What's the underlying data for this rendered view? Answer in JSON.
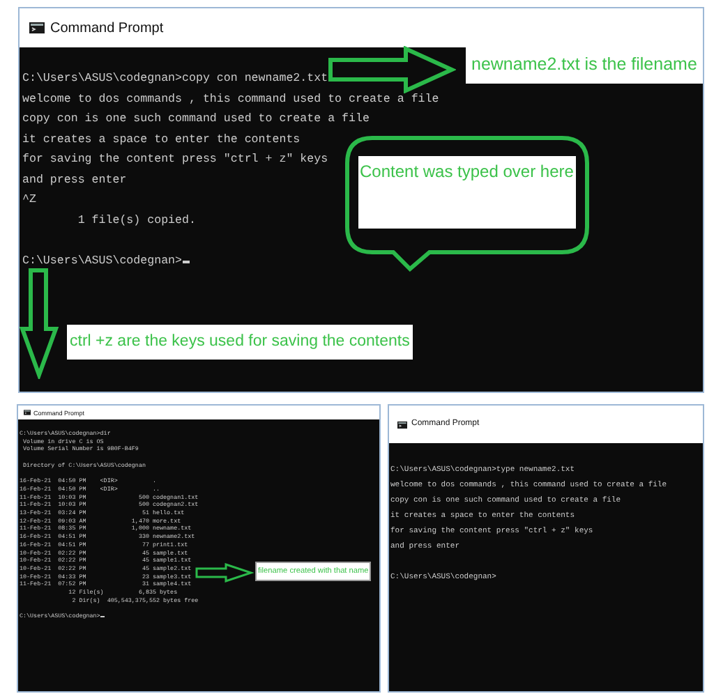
{
  "windows": [
    {
      "title": "Command Prompt",
      "cursor": true,
      "blocks": [
        [
          "C:\\Users\\ASUS\\codegnan>copy con newname2.txt",
          "welcome to dos commands , this command used to create a file",
          "copy con is one such command used to create a file",
          "it creates a space to enter the contents",
          "for saving the content press \"ctrl + z\" keys",
          "and press enter",
          "^Z",
          "        1 file(s) copied."
        ],
        [
          "C:\\Users\\ASUS\\codegnan>"
        ]
      ],
      "callouts": [
        {
          "kind": "right_arrow",
          "text": "newname2.txt is the filename"
        },
        {
          "kind": "speech_bubble",
          "text": "Content was typed over here"
        },
        {
          "kind": "down_arrow",
          "text": "ctrl +z are the keys used for saving the contents"
        }
      ]
    },
    {
      "title": "Command Prompt",
      "cursor": true,
      "blocks": [
        [
          "C:\\Users\\ASUS\\codegnan>dir",
          " Volume in drive C is OS",
          " Volume Serial Number is 9B0F-B4F9"
        ],
        [
          " Directory of C:\\Users\\ASUS\\codegnan"
        ],
        [
          "16-Feb-21  04:50 PM    <DIR>          .",
          "16-Feb-21  04:50 PM    <DIR>          ..",
          "11-Feb-21  10:03 PM               500 codegnan1.txt",
          "11-Feb-21  10:03 PM               500 codegnan2.txt",
          "13-Feb-21  03:24 PM                51 hello.txt",
          "12-Feb-21  09:03 AM             1,470 more.txt",
          "11-Feb-21  08:35 PM             1,000 newname.txt",
          "16-Feb-21  04:51 PM               330 newname2.txt",
          "16-Feb-21  04:51 PM                77 print1.txt",
          "10-Feb-21  02:22 PM                45 sample.txt",
          "10-Feb-21  02:22 PM                45 sample1.txt",
          "10-Feb-21  02:22 PM                45 sample2.txt",
          "10-Feb-21  04:33 PM                23 sample3.txt",
          "11-Feb-21  07:52 PM                31 sample4.txt",
          "              12 File(s)          6,835 bytes",
          "               2 Dir(s)  405,543,375,552 bytes free"
        ],
        [
          "C:\\Users\\ASUS\\codegnan>"
        ]
      ],
      "callouts": [
        {
          "kind": "right_arrow",
          "text": "filename created with that name"
        }
      ]
    },
    {
      "title": "Command Prompt",
      "cursor": false,
      "blocks": [
        [
          "C:\\Users\\ASUS\\codegnan>type newname2.txt",
          "welcome to dos commands , this command used to create a file",
          "copy con is one such command used to create a file",
          "it creates a space to enter the contents",
          "for saving the content press \"ctrl + z\" keys",
          "and press enter"
        ],
        [
          "C:\\Users\\ASUS\\codegnan>"
        ]
      ]
    }
  ]
}
